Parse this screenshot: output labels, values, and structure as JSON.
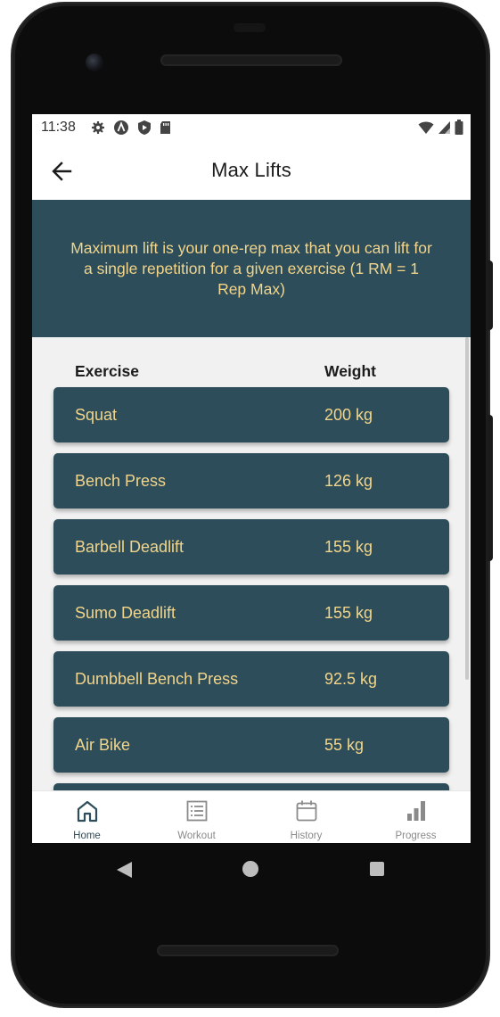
{
  "status_bar": {
    "time": "11:38",
    "left_icons": [
      "gear-icon",
      "a-badge-icon",
      "shield-icon",
      "sd-card-icon"
    ],
    "right_icons": [
      "wifi-icon",
      "signal-icon",
      "battery-icon"
    ]
  },
  "app_bar": {
    "title": "Max Lifts",
    "back_icon": "arrow-left-icon"
  },
  "banner": {
    "text": "Maximum lift is your one-rep max that you can lift for a single repetition for a given exercise (1 RM = 1 Rep Max)"
  },
  "list": {
    "headers": {
      "exercise": "Exercise",
      "weight": "Weight"
    },
    "rows": [
      {
        "exercise": "Squat",
        "weight": "200 kg"
      },
      {
        "exercise": "Bench Press",
        "weight": "126 kg"
      },
      {
        "exercise": "Barbell Deadlift",
        "weight": "155 kg"
      },
      {
        "exercise": "Sumo Deadlift",
        "weight": "155 kg"
      },
      {
        "exercise": "Dumbbell Bench Press",
        "weight": "92.5 kg"
      },
      {
        "exercise": "Air Bike",
        "weight": "55 kg"
      },
      {
        "exercise": "",
        "weight": ""
      }
    ]
  },
  "bottom_nav": {
    "items": [
      {
        "label": "Home",
        "icon": "home-icon",
        "active": true
      },
      {
        "label": "Workout",
        "icon": "list-icon",
        "active": false
      },
      {
        "label": "History",
        "icon": "calendar-icon",
        "active": false
      },
      {
        "label": "Progress",
        "icon": "bar-chart-icon",
        "active": false
      }
    ]
  },
  "colors": {
    "accent": "#2d4d5a",
    "accent_text": "#f2d58a",
    "background": "#f1f1f1",
    "inactive_nav": "#8a8a8a"
  },
  "system_nav": {
    "icons": [
      "back-triangle-icon",
      "home-circle-icon",
      "recents-square-icon"
    ]
  }
}
